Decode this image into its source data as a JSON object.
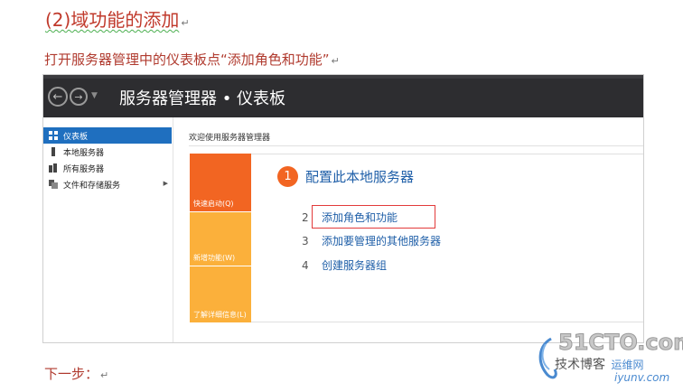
{
  "doc": {
    "heading": "(2)域功能的添加",
    "instruction": "打开服务器管理中的仪表板点“添加角色和功能”",
    "next": "下一步：",
    "para_mark": "↵"
  },
  "window": {
    "title": "服务器管理器 • 仪表板"
  },
  "sidebar": {
    "items": [
      {
        "label": "仪表板",
        "icon": "dashboard-icon"
      },
      {
        "label": "本地服务器",
        "icon": "server-icon"
      },
      {
        "label": "所有服务器",
        "icon": "servers-icon"
      },
      {
        "label": "文件和存储服务",
        "icon": "storage-icon"
      }
    ]
  },
  "main": {
    "welcome": "欢迎使用服务器管理器",
    "tiles": {
      "quick": "快速启动(Q)",
      "new": "新增功能(W)",
      "learn": "了解详细信息(L)"
    },
    "step1": {
      "num": "1",
      "label": "配置此本地服务器"
    },
    "steps": [
      {
        "num": "2",
        "label": "添加角色和功能"
      },
      {
        "num": "3",
        "label": "添加要管理的其他服务器"
      },
      {
        "num": "4",
        "label": "创建服务器组"
      }
    ]
  },
  "watermark": {
    "brand": "51CTO.com",
    "line2": "技术博客",
    "line2b": "运维网",
    "url": "iyunv.com"
  },
  "colors": {
    "accent_orange": "#f26522",
    "tile_yellow": "#fbb03b",
    "link_blue": "#1f5fa8",
    "highlight_red": "#e23b3b"
  }
}
